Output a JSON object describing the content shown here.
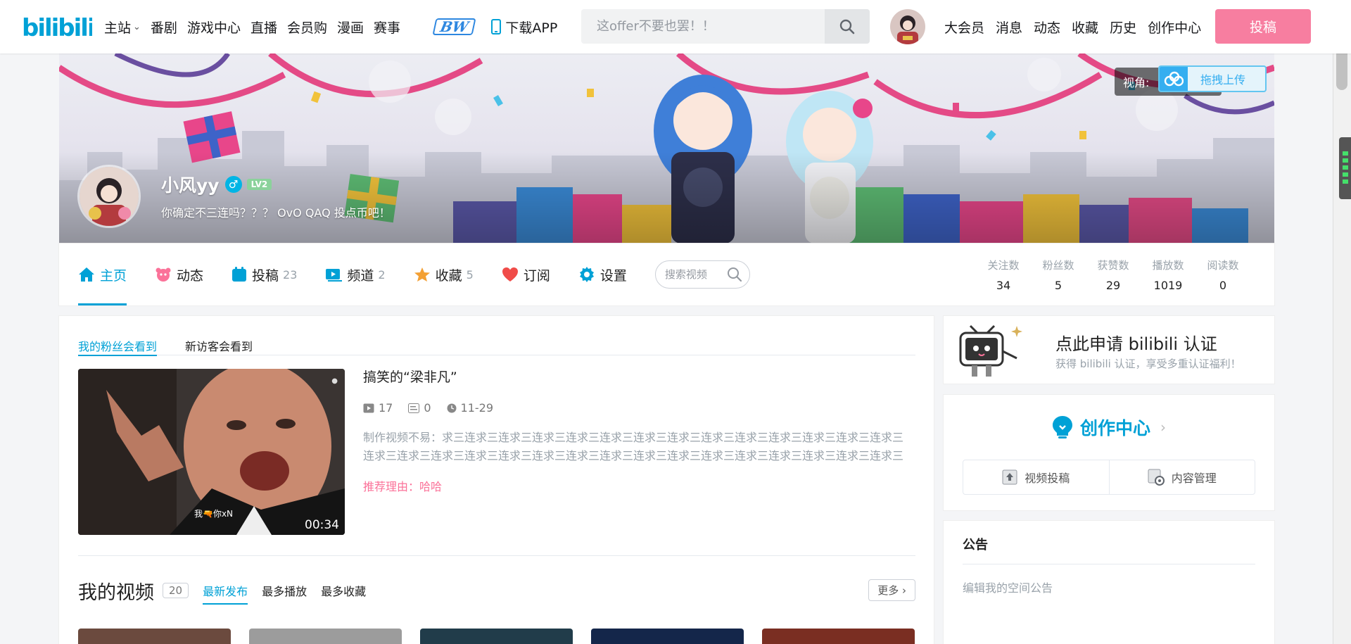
{
  "header": {
    "logo_text": "bilibili",
    "nav_left": [
      "主站",
      "番剧",
      "游戏中心",
      "直播",
      "会员购",
      "漫画",
      "赛事"
    ],
    "bw_badge": "BW",
    "download_app": "下载APP",
    "search_placeholder": "这offer不要也罢！！",
    "nav_right": [
      "大会员",
      "消息",
      "动态",
      "收藏",
      "历史",
      "创作中心"
    ],
    "upload_label": "投稿",
    "accent": "#00a1d6",
    "upload_color": "#f77ea0"
  },
  "banner": {
    "username": "小风yy",
    "level": "LV2",
    "sign": "你确定不三连吗？？？ OvO QAQ 投点币吧！",
    "view_label": "视角:",
    "drag_upload_label": "拖拽上传"
  },
  "tabs": [
    {
      "label": "主页",
      "count": "",
      "icon": "home-icon",
      "color": "#00a1d6"
    },
    {
      "label": "动态",
      "count": "",
      "icon": "dynamic-icon",
      "color": "#fb7299"
    },
    {
      "label": "投稿",
      "count": "23",
      "icon": "upload-icon",
      "color": "#00a1d6"
    },
    {
      "label": "频道",
      "count": "2",
      "icon": "channel-icon",
      "color": "#00a1d6"
    },
    {
      "label": "收藏",
      "count": "5",
      "icon": "favorite-star-icon",
      "color": "#f3a034"
    },
    {
      "label": "订阅",
      "count": "",
      "icon": "subscribe-heart-icon",
      "color": "#f04c49"
    },
    {
      "label": "设置",
      "count": "",
      "icon": "settings-gear-icon",
      "color": "#00a1d6"
    }
  ],
  "tab_search_placeholder": "搜索视频",
  "stats": [
    {
      "label": "关注数",
      "value": "34"
    },
    {
      "label": "粉丝数",
      "value": "5"
    },
    {
      "label": "获赞数",
      "value": "29"
    },
    {
      "label": "播放数",
      "value": "1019"
    },
    {
      "label": "阅读数",
      "value": "0"
    }
  ],
  "main": {
    "sub_tabs": [
      "我的粉丝会看到",
      "新访客会看到"
    ],
    "featured": {
      "title": "搞笑的“梁非凡”",
      "plays": "17",
      "danmaku": "0",
      "date": "11-29",
      "duration": "00:34",
      "subtitle_text": "我🔫你xN",
      "desc": "制作视频不易：求三连求三连求三连求三连求三连求三连求三连求三连求三连求三连求三连求三连求三连求三连求三连求三连求三连求三连求三连求三连求三连求三连求三连求三连求三连求三连求三连求三连求三连求三连求三连求三连",
      "reason": "推荐理由：哈哈"
    },
    "my_videos": {
      "title": "我的视频",
      "count": "20",
      "sorts": [
        "最新发布",
        "最多播放",
        "最多收藏"
      ],
      "more": "更多"
    }
  },
  "cert": {
    "title": "点此申请 bilibili 认证",
    "subtitle": "获得 bilibili 认证，享受多重认证福利！"
  },
  "creator": {
    "title": "创作中心",
    "actions": [
      "视频投稿",
      "内容管理"
    ]
  },
  "notice": {
    "title": "公告",
    "placeholder": "编辑我的空间公告"
  }
}
